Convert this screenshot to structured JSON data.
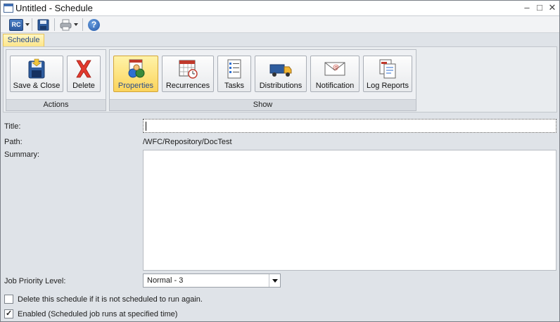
{
  "window": {
    "title": "Untitled - Schedule"
  },
  "quick_access": {
    "logo_text": "RC",
    "help_glyph": "?",
    "icons": [
      "report-caster-icon",
      "save-icon",
      "print-icon",
      "help-icon"
    ]
  },
  "tab": {
    "label": "Schedule"
  },
  "ribbon": {
    "groups": [
      {
        "label": "Actions",
        "buttons": [
          {
            "label": "Save & Close",
            "icon": "save-close-icon"
          },
          {
            "label": "Delete",
            "icon": "delete-icon"
          }
        ]
      },
      {
        "label": "Show",
        "buttons": [
          {
            "label": "Properties",
            "icon": "properties-icon",
            "active": true
          },
          {
            "label": "Recurrences",
            "icon": "calendar-icon"
          },
          {
            "label": "Tasks",
            "icon": "tasks-icon"
          },
          {
            "label": "Distributions",
            "icon": "truck-icon"
          },
          {
            "label": "Notification",
            "icon": "mail-icon"
          },
          {
            "label": "Log Reports",
            "icon": "log-report-icon"
          }
        ]
      }
    ]
  },
  "form": {
    "title_label": "Title:",
    "title_value": "",
    "path_label": "Path:",
    "path_value": "/WFC/Repository/DocTest",
    "summary_label": "Summary:",
    "summary_value": "",
    "priority_label": "Job Priority Level:",
    "priority_value": "Normal - 3",
    "delete_checkbox_label": "Delete this schedule if it is not scheduled to run again.",
    "delete_checked": false,
    "enabled_checkbox_label": "Enabled (Scheduled job runs at specified time)",
    "enabled_checked": true
  },
  "colors": {
    "accent_tab": "#fde58a",
    "active_button": "#fbd45c",
    "link_blue": "#2a4d8c"
  }
}
